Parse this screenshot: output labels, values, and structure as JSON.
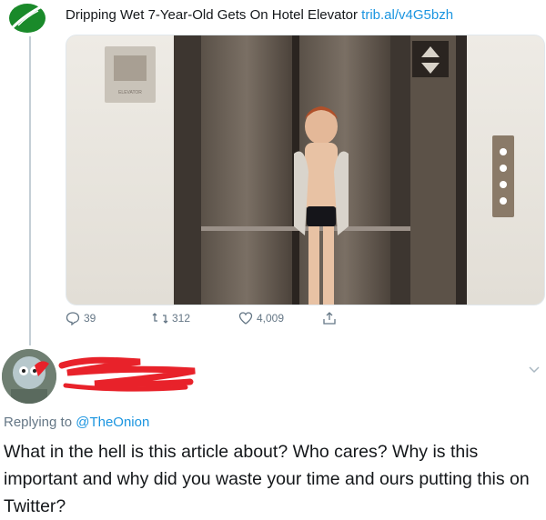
{
  "tweet": {
    "headline": "Dripping Wet 7-Year-Old Gets On Hotel Elevator",
    "link": "trib.al/v4G5bzh",
    "elevator_sign": "ELEVATOR",
    "stats": {
      "replies": "39",
      "retweets": "312",
      "likes": "4,009"
    }
  },
  "reply": {
    "replying_prefix": "Replying to",
    "replying_handle": "@TheOnion",
    "text": "What in the hell is this article about? Who cares? Why is this important and why did you waste your time and ours putting this on Twitter?"
  },
  "colors": {
    "link": "#1b95e0",
    "muted": "#657786",
    "onion_green": "#1a8a2a",
    "scribble_red": "#e8222a"
  },
  "icons": {
    "reply": "reply-icon",
    "retweet": "retweet-icon",
    "like": "heart-icon",
    "share": "share-icon",
    "more": "chevron-down-icon"
  }
}
